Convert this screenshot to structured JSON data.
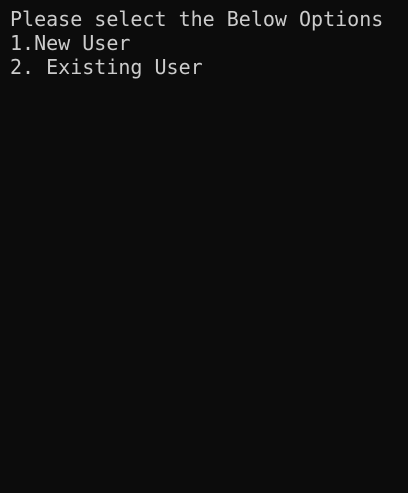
{
  "console": {
    "background": "#0c0c0c",
    "foreground": "#cccccc",
    "lines": [
      "Please select the Below Options",
      "1.New User",
      "2. Existing User"
    ]
  }
}
